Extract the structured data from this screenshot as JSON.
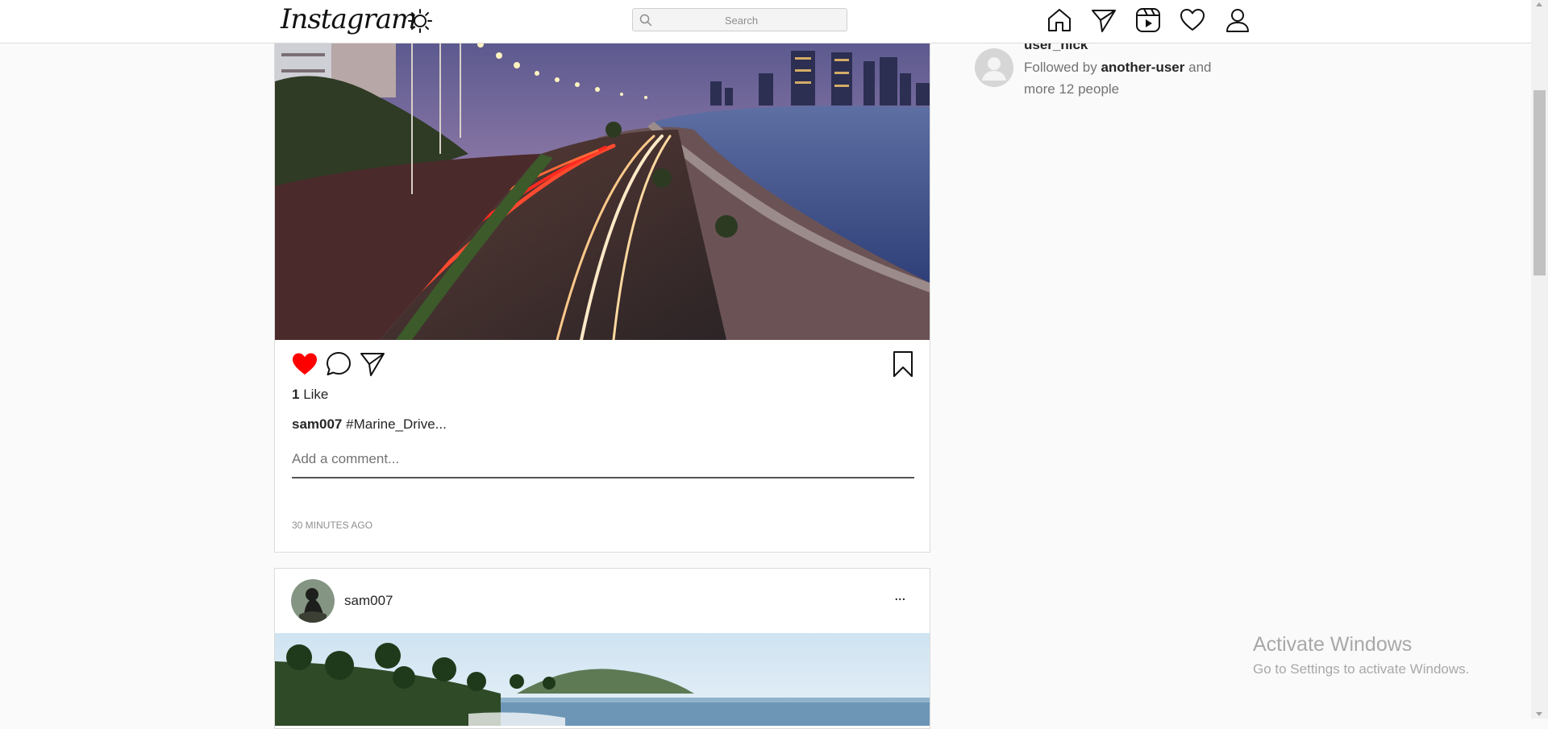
{
  "nav": {
    "logo": "Instagram",
    "search_placeholder": "Search",
    "icons": [
      "sun-icon",
      "home-icon",
      "send-icon",
      "reels-icon",
      "heart-icon",
      "profile-icon"
    ]
  },
  "feed": {
    "post1": {
      "likes_count": "1",
      "likes_label": "Like",
      "liked": true,
      "caption_user": "sam007",
      "caption_text": "#Marine_Drive...",
      "comment_placeholder": "Add a comment...",
      "timestamp": "30 MINUTES AGO"
    },
    "post2": {
      "username": "sam007",
      "more_label": "..."
    }
  },
  "suggestion": {
    "username": "user_nick",
    "followed_prefix": "Followed by",
    "followed_user": "another-user",
    "followed_suffix": "and more 12 people"
  },
  "watermark": {
    "title": "Activate Windows",
    "subtitle": "Go to Settings to activate Windows."
  },
  "colors": {
    "like_red": "#ff0000",
    "border": "#dbdbdb",
    "background": "#fafafa"
  }
}
